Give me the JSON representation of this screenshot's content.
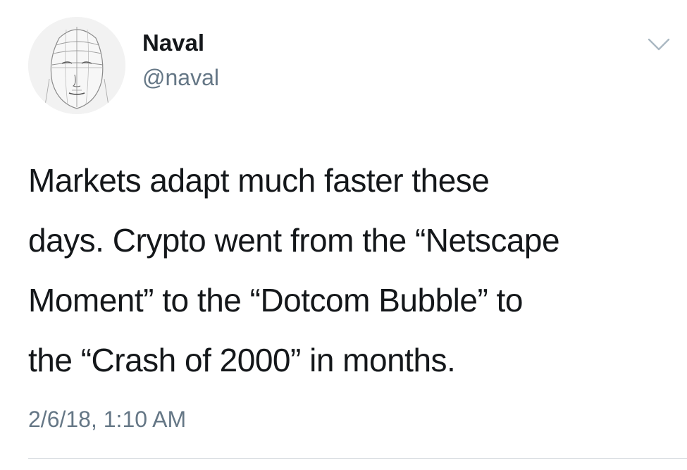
{
  "author": {
    "display_name": "Naval",
    "handle": "@naval",
    "avatar_icon": "sketched-face-avatar"
  },
  "menu": {
    "icon": "chevron-down-icon"
  },
  "tweet": {
    "lines": [
      "Markets adapt much faster these",
      "days. Crypto went from the “Netscape",
      "Moment” to the “Dotcom Bubble” to",
      "the “Crash of 2000” in months."
    ],
    "timestamp": "2/6/18, 1:10 AM"
  },
  "colors": {
    "text": "#14171a",
    "secondary": "#657786",
    "divider": "#d8dde1"
  }
}
